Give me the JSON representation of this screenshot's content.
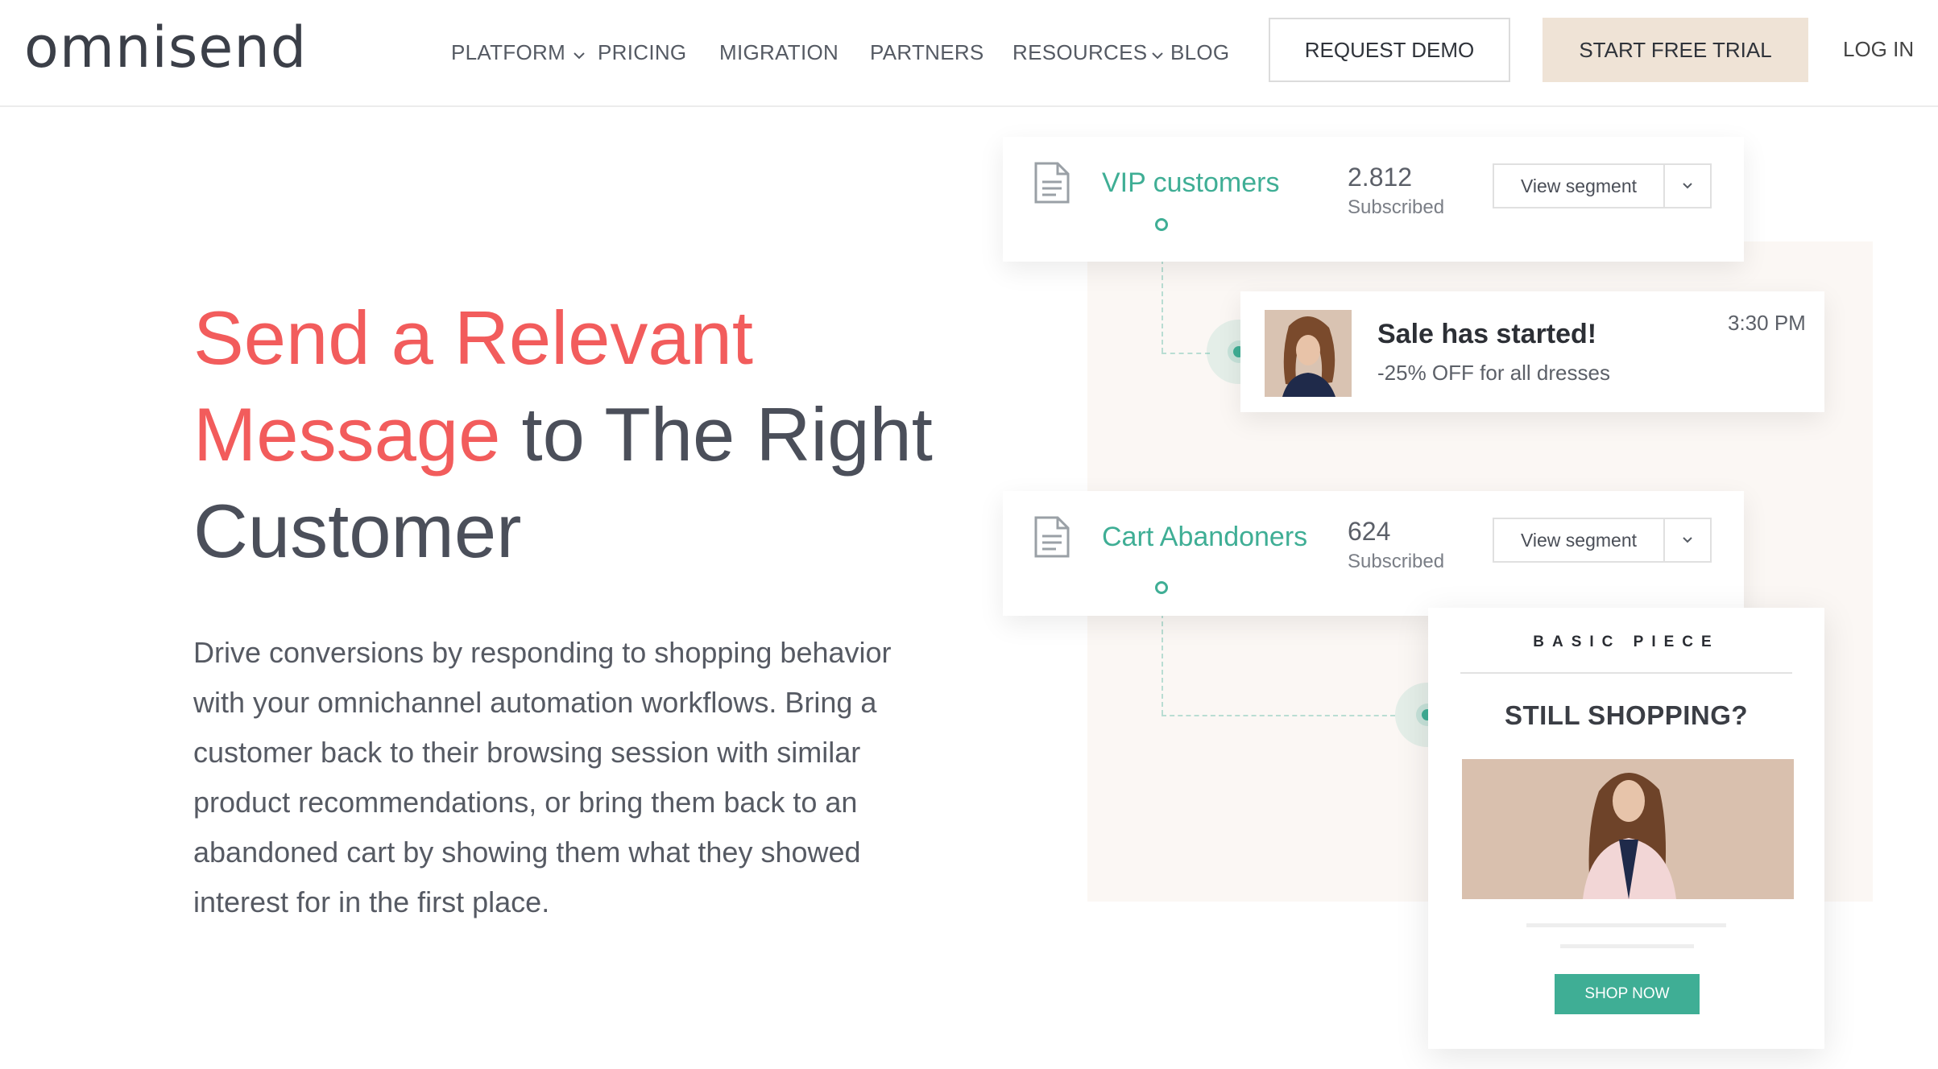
{
  "header": {
    "logo": "omnisend",
    "nav": [
      {
        "label": "PLATFORM",
        "has_dropdown": true
      },
      {
        "label": "PRICING",
        "has_dropdown": false
      },
      {
        "label": "MIGRATION",
        "has_dropdown": false
      },
      {
        "label": "PARTNERS",
        "has_dropdown": false
      },
      {
        "label": "RESOURCES",
        "has_dropdown": true
      },
      {
        "label": "BLOG",
        "has_dropdown": false
      }
    ],
    "request_demo": "REQUEST DEMO",
    "start_trial": "START FREE TRIAL",
    "login": "LOG IN"
  },
  "hero": {
    "headline_accent": "Send a Relevant Message",
    "headline_rest": "to The Right Customer",
    "body": "Drive conversions by responding to shopping behavior with your omnichannel automation workflows. Bring a customer back to their browsing session with similar product recommendations, or bring them back to an abandoned cart by showing them what they showed interest for in the first place."
  },
  "illustration": {
    "segments": [
      {
        "name": "VIP customers",
        "count": "2.812",
        "sub": "Subscribed",
        "button": "View segment"
      },
      {
        "name": "Cart Abandoners",
        "count": "624",
        "sub": "Subscribed",
        "button": "View segment"
      }
    ],
    "notification": {
      "title": "Sale has started!",
      "subtitle": "-25% OFF for all dresses",
      "time": "3:30 PM"
    },
    "email": {
      "brand": "BASIC PIECE",
      "heading": "STILL SHOPPING?",
      "button": "SHOP NOW"
    }
  },
  "colors": {
    "accent_red": "#f25c5c",
    "brand_green": "#3fae95",
    "trial_bg": "#efe3d6"
  }
}
